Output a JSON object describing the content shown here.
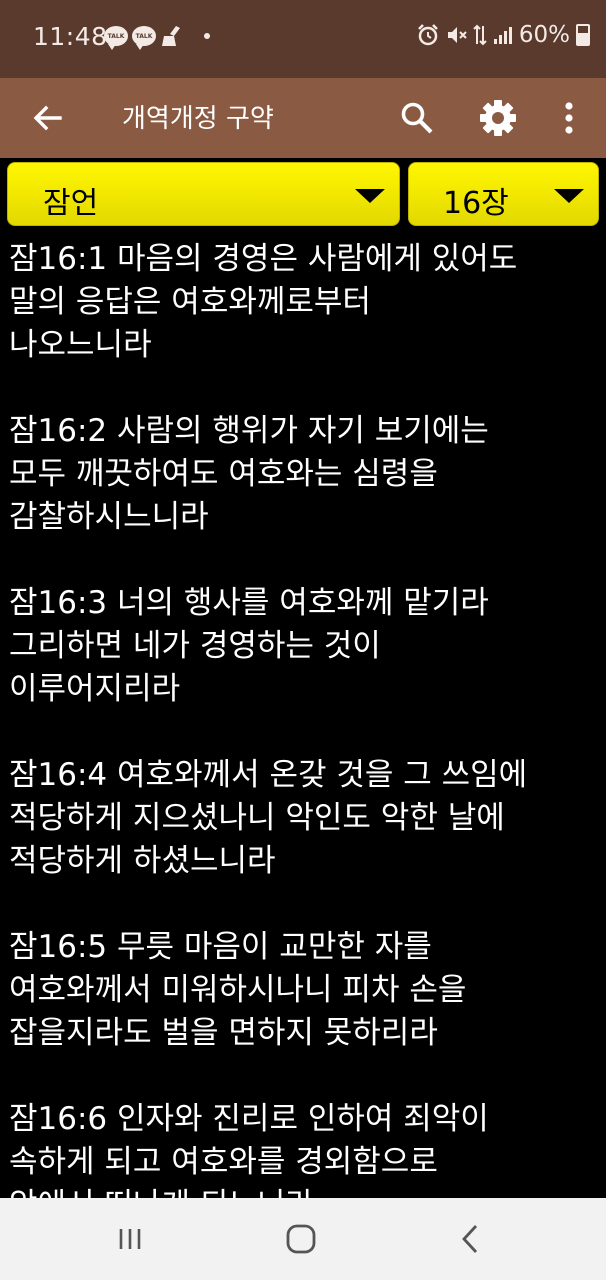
{
  "status_bar": {
    "time": "11:48",
    "notification_icons": [
      "talk-icon",
      "talk-icon",
      "cleaner-icon",
      "dot-icon"
    ],
    "system_icons": [
      "alarm-icon",
      "mute-icon",
      "data-icon",
      "signal-icon"
    ],
    "battery_text": "60%",
    "talk_label": "TALK"
  },
  "app_bar": {
    "title": "개역개정 구약",
    "back_icon": "arrow-back-icon",
    "search_icon": "search-icon",
    "settings_icon": "gear-icon",
    "more_icon": "more-vertical-icon"
  },
  "selectors": {
    "book": "잠언",
    "chapter": "16장"
  },
  "verses": [
    {
      "lines": [
        "잠16:1 마음의 경영은 사람에게 있어도",
        "말의 응답은 여호와께로부터",
        "나오느니라"
      ]
    },
    {
      "lines": [
        "잠16:2 사람의 행위가 자기 보기에는",
        "모두 깨끗하여도 여호와는 심령을",
        "감찰하시느니라"
      ]
    },
    {
      "lines": [
        "잠16:3 너의 행사를 여호와께 맡기라",
        "그리하면 네가 경영하는 것이",
        "이루어지리라"
      ]
    },
    {
      "lines": [
        "잠16:4 여호와께서 온갖 것을 그 쓰임에",
        "적당하게 지으셨나니 악인도 악한 날에",
        "적당하게 하셨느니라"
      ]
    },
    {
      "lines": [
        "잠16:5 무릇 마음이 교만한 자를",
        "여호와께서 미워하시나니 피차 손을",
        "잡을지라도 벌을 면하지 못하리라"
      ]
    },
    {
      "lines": [
        "잠16:6 인자와 진리로 인하여 죄악이",
        "속하게 되고 여호와를 경외함으로",
        "악에서 떠나게 되느니라"
      ]
    }
  ],
  "nav_bar": {
    "recents_icon": "recents-icon",
    "home_icon": "home-icon",
    "back_icon": "nav-back-icon"
  }
}
